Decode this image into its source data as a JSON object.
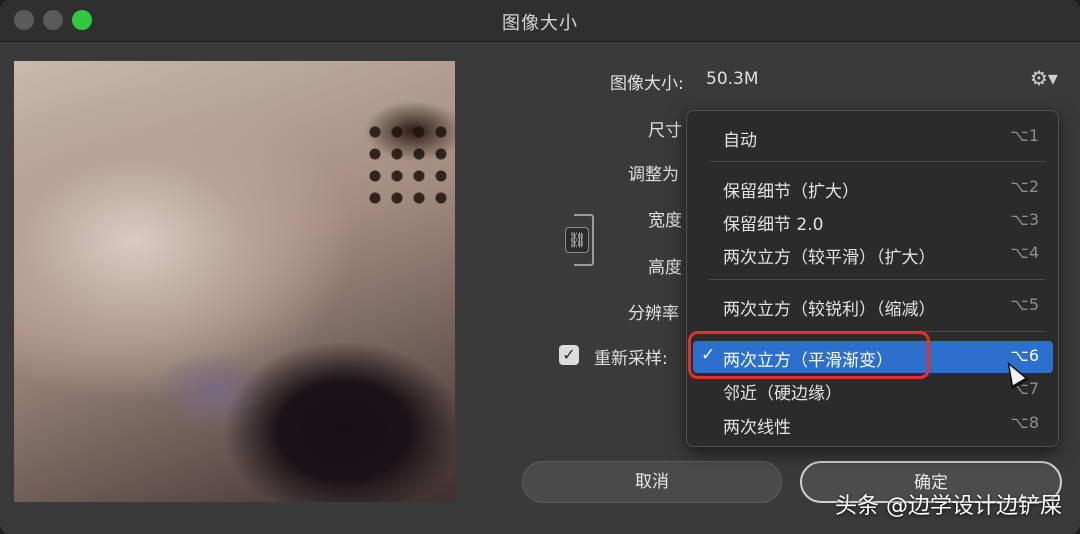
{
  "window": {
    "title": "图像大小"
  },
  "info": {
    "size_label": "图像大小:",
    "size_value": "50.3M"
  },
  "labels": {
    "dimensions": "尺寸",
    "fit_to": "调整为",
    "width": "宽度",
    "height": "高度",
    "resolution": "分辨率",
    "resample": "重新采样:"
  },
  "resample": {
    "checked": true
  },
  "menu": {
    "items": [
      {
        "label": "自动",
        "shortcut": "⌥1",
        "selected": false
      },
      {
        "label": "保留细节（扩大）",
        "shortcut": "⌥2",
        "selected": false
      },
      {
        "label": "保留细节 2.0",
        "shortcut": "⌥3",
        "selected": false
      },
      {
        "label": "两次立方（较平滑）（扩大）",
        "shortcut": "⌥4",
        "selected": false
      },
      {
        "label": "两次立方（较锐利）（缩减）",
        "shortcut": "⌥5",
        "selected": false
      },
      {
        "label": "两次立方（平滑渐变）",
        "shortcut": "⌥6",
        "selected": true
      },
      {
        "label": "邻近（硬边缘）",
        "shortcut": "⌥7",
        "selected": false
      },
      {
        "label": "两次线性",
        "shortcut": "⌥8",
        "selected": false
      }
    ]
  },
  "buttons": {
    "cancel": "取消",
    "ok": "确定"
  },
  "icons": {
    "settings": "gear-icon",
    "link": "link-icon",
    "check": "checkmark-icon"
  },
  "colors": {
    "selection": "#2d6fcd",
    "highlight": "#e4302b",
    "zoom": "#2fc840"
  },
  "watermark": "头条 @边学设计边铲屎"
}
